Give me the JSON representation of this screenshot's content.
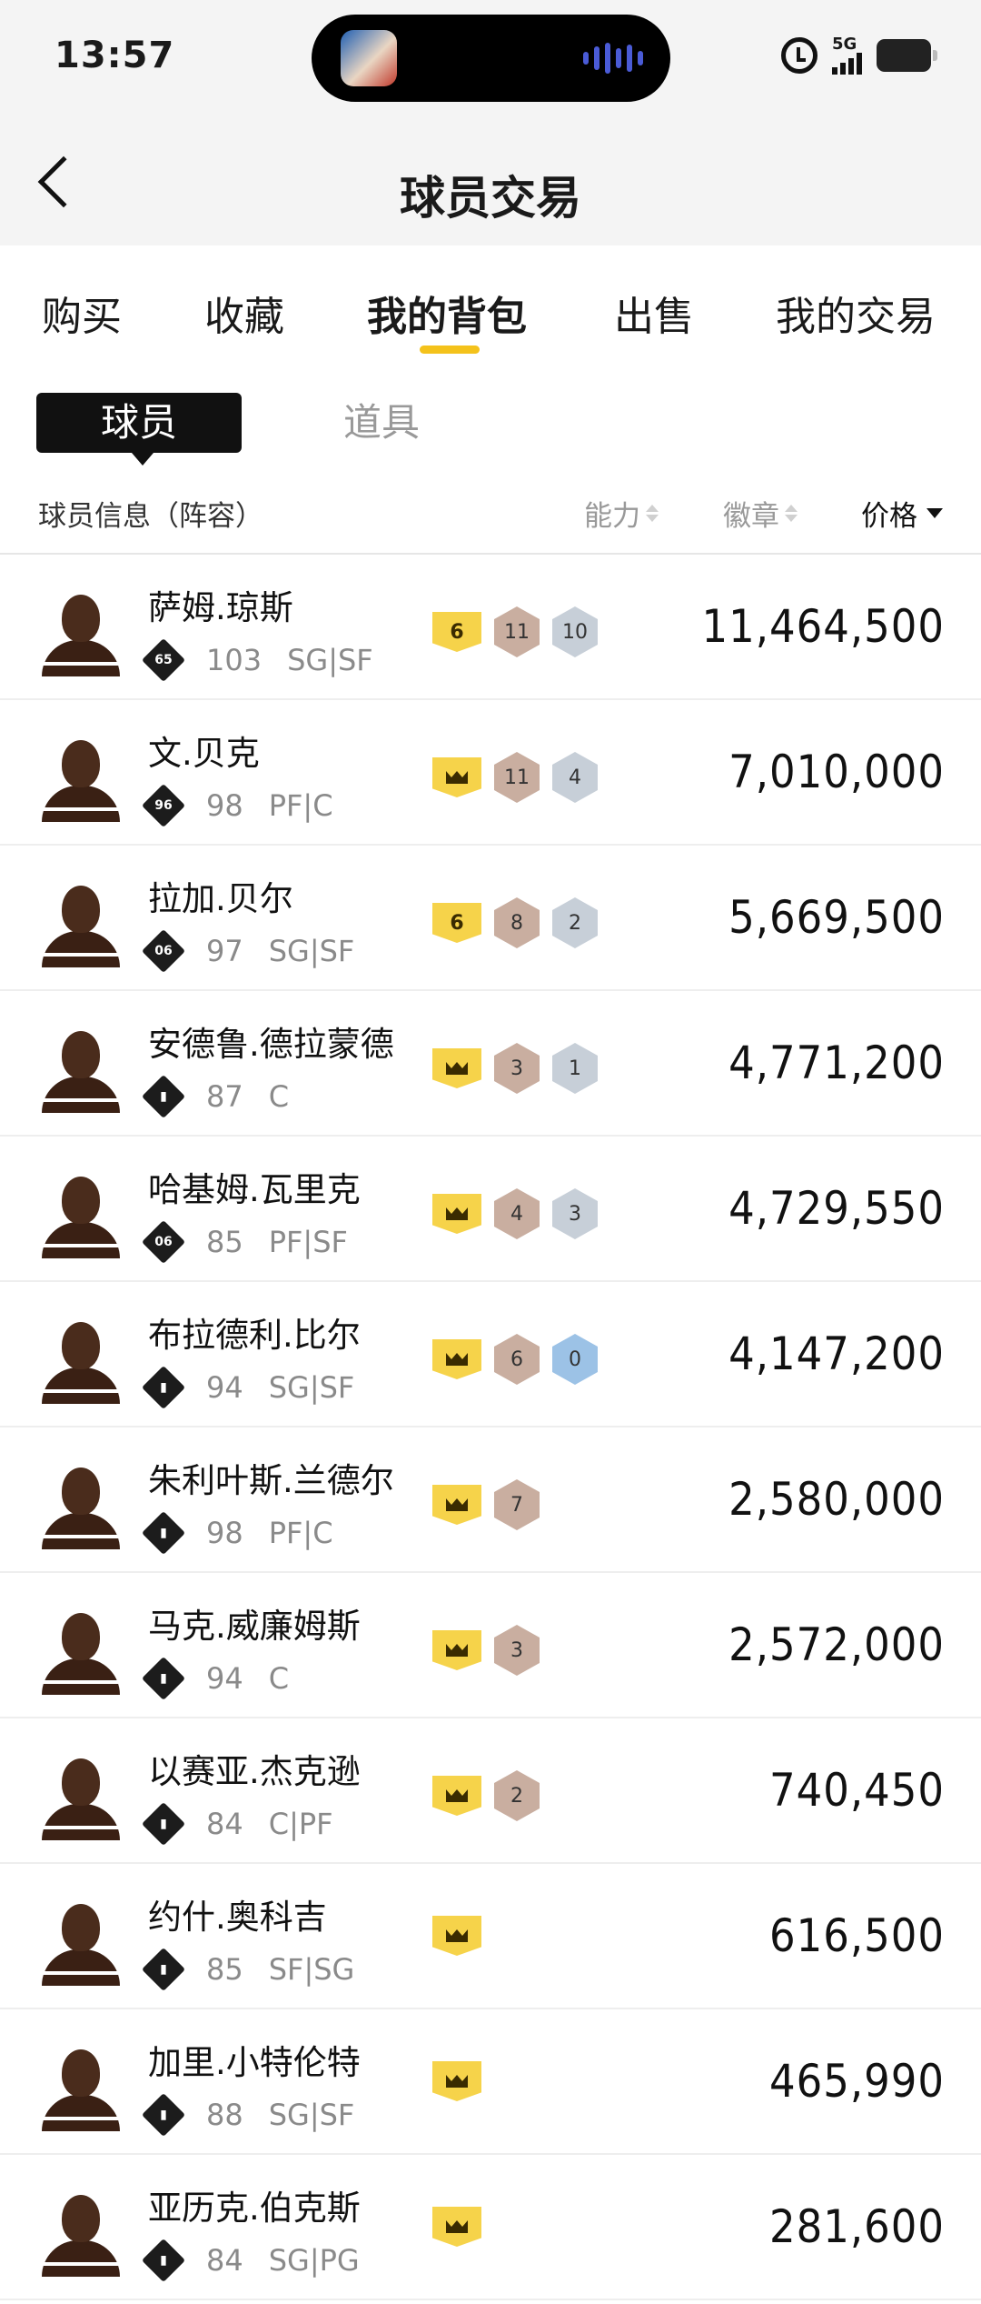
{
  "status_bar": {
    "time": "13:57",
    "network": "5G"
  },
  "nav": {
    "title": "球员交易"
  },
  "tabs": [
    {
      "label": "购买",
      "active": false
    },
    {
      "label": "收藏",
      "active": false
    },
    {
      "label": "我的背包",
      "active": true
    },
    {
      "label": "出售",
      "active": false
    },
    {
      "label": "我的交易",
      "active": false
    }
  ],
  "segment": {
    "active": "球员",
    "inactive": "道具"
  },
  "columns": {
    "info": "球员信息（阵容）",
    "ability": "能力",
    "badge": "徽章",
    "price": "价格"
  },
  "colors": {
    "accent": "#f4c21b",
    "badge_gold": "#f6d34a",
    "badge_bronze": "#c9aea0",
    "badge_silver": "#c7cfd8",
    "badge_blue": "#9cc2e6"
  },
  "players": [
    {
      "name": "萨姆.琼斯",
      "tier": "65",
      "ovr": "103",
      "pos": "SG|SF",
      "level": "6",
      "bronze": "11",
      "silver": "10",
      "silver_color": "silver",
      "price": "11,464,500"
    },
    {
      "name": "文.贝克",
      "tier": "96",
      "ovr": "98",
      "pos": "PF|C",
      "level": "",
      "bronze": "11",
      "silver": "4",
      "silver_color": "silver",
      "price": "7,010,000"
    },
    {
      "name": "拉加.贝尔",
      "tier": "06",
      "ovr": "97",
      "pos": "SG|SF",
      "level": "6",
      "bronze": "8",
      "silver": "2",
      "silver_color": "silver",
      "price": "5,669,500"
    },
    {
      "name": "安德鲁.德拉蒙德",
      "tier": "",
      "ovr": "87",
      "pos": "C",
      "level": "",
      "bronze": "3",
      "silver": "1",
      "silver_color": "silver",
      "price": "4,771,200"
    },
    {
      "name": "哈基姆.瓦里克",
      "tier": "06",
      "ovr": "85",
      "pos": "PF|SF",
      "level": "",
      "bronze": "4",
      "silver": "3",
      "silver_color": "silver",
      "price": "4,729,550"
    },
    {
      "name": "布拉德利.比尔",
      "tier": "",
      "ovr": "94",
      "pos": "SG|SF",
      "level": "",
      "bronze": "6",
      "silver": "0",
      "silver_color": "blue",
      "price": "4,147,200"
    },
    {
      "name": "朱利叶斯.兰德尔",
      "tier": "",
      "ovr": "98",
      "pos": "PF|C",
      "level": "",
      "bronze": "7",
      "silver": "",
      "silver_color": "",
      "price": "2,580,000"
    },
    {
      "name": "马克.威廉姆斯",
      "tier": "",
      "ovr": "94",
      "pos": "C",
      "level": "",
      "bronze": "3",
      "silver": "",
      "silver_color": "",
      "price": "2,572,000"
    },
    {
      "name": "以赛亚.杰克逊",
      "tier": "",
      "ovr": "84",
      "pos": "C|PF",
      "level": "",
      "bronze": "2",
      "silver": "",
      "silver_color": "",
      "price": "740,450"
    },
    {
      "name": "约什.奥科吉",
      "tier": "",
      "ovr": "85",
      "pos": "SF|SG",
      "level": "",
      "bronze": "",
      "silver": "",
      "silver_color": "",
      "price": "616,500"
    },
    {
      "name": "加里.小特伦特",
      "tier": "",
      "ovr": "88",
      "pos": "SG|SF",
      "level": "",
      "bronze": "",
      "silver": "",
      "silver_color": "",
      "price": "465,990"
    },
    {
      "name": "亚历克.伯克斯",
      "tier": "",
      "ovr": "84",
      "pos": "SG|PG",
      "level": "",
      "bronze": "",
      "silver": "",
      "silver_color": "",
      "price": "281,600"
    }
  ]
}
